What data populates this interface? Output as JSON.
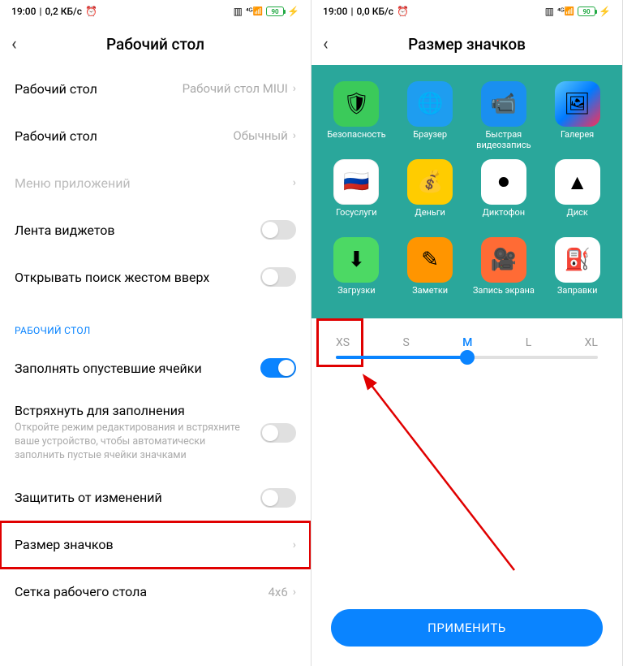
{
  "left": {
    "status": {
      "time": "19:00",
      "speed": "0,2 КБ/с",
      "battery": "90"
    },
    "title": "Рабочий стол",
    "rows": {
      "launcher": {
        "label": "Рабочий стол",
        "value": "Рабочий стол MIUI"
      },
      "mode": {
        "label": "Рабочий стол",
        "value": "Обычный"
      },
      "appmenu": {
        "label": "Меню приложений"
      },
      "widgets": {
        "label": "Лента виджетов"
      },
      "swipe": {
        "label": "Открывать поиск жестом вверх"
      }
    },
    "section": "РАБОЧИЙ СТОЛ",
    "rows2": {
      "fill": {
        "label": "Заполнять опустевшие ячейки"
      },
      "shake": {
        "label": "Встряхнуть для заполнения",
        "desc": "Откройте режим редактирования и встряхните ваше устройство, чтобы автоматически заполнить пустые ячейки значками"
      },
      "lock": {
        "label": "Защитить от изменений"
      },
      "iconsize": {
        "label": "Размер значков"
      },
      "grid": {
        "label": "Сетка рабочего стола",
        "value": "4x6"
      }
    }
  },
  "right": {
    "status": {
      "time": "19:00",
      "speed": "0,0 КБ/с",
      "battery": "90"
    },
    "title": "Размер значков",
    "apps": [
      {
        "name": "Безопасность",
        "icon": "shield"
      },
      {
        "name": "Браузер",
        "icon": "browser"
      },
      {
        "name": "Быстрая видеозапись",
        "icon": "cam"
      },
      {
        "name": "Галерея",
        "icon": "gallery"
      },
      {
        "name": "Госуслуги",
        "icon": "gos"
      },
      {
        "name": "Деньги",
        "icon": "money"
      },
      {
        "name": "Диктофон",
        "icon": "rec"
      },
      {
        "name": "Диск",
        "icon": "disk"
      },
      {
        "name": "Загрузки",
        "icon": "down"
      },
      {
        "name": "Заметки",
        "icon": "notes"
      },
      {
        "name": "Запись экрана",
        "icon": "vid"
      },
      {
        "name": "Заправки",
        "icon": "fuel"
      }
    ],
    "sizes": {
      "xs": "XS",
      "s": "S",
      "m": "M",
      "l": "L",
      "xl": "XL"
    },
    "apply": "ПРИМЕНИТЬ"
  }
}
